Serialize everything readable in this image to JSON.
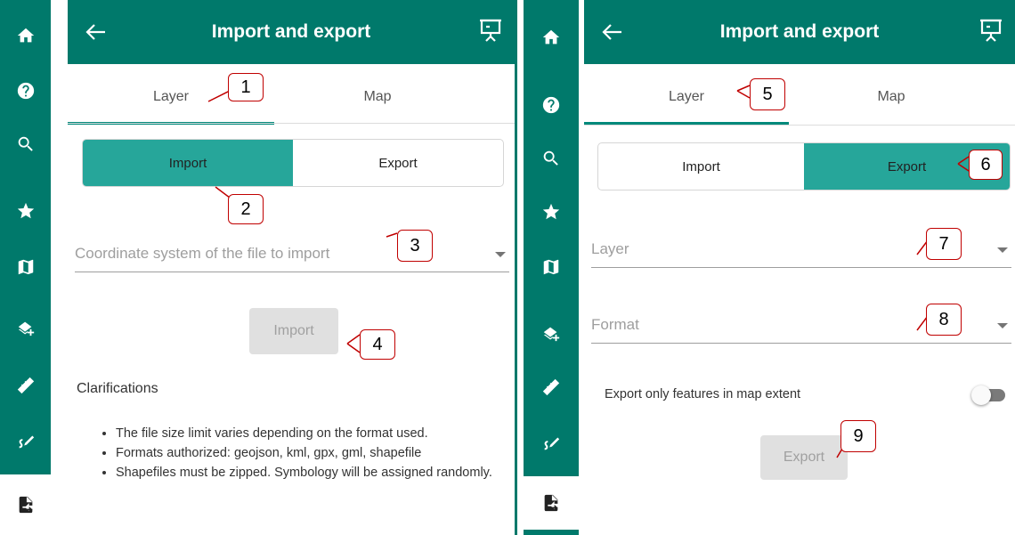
{
  "colors": {
    "primary": "#00796b",
    "accent": "#26a69a",
    "callout": "#c00000"
  },
  "rail_icons": [
    "home-icon",
    "help-icon",
    "search-icon",
    "star-icon",
    "map-icon",
    "add-layer-icon",
    "ruler-icon",
    "draw-icon",
    "import-export-icon"
  ],
  "left": {
    "header": {
      "title": "Import and export"
    },
    "tabs": [
      "Layer",
      "Map"
    ],
    "segment": {
      "import": "Import",
      "export": "Export"
    },
    "select_placeholder": "Coordinate system of the file to import",
    "import_button": "Import",
    "clarifications_title": "Clarifications",
    "notes": [
      "The file size limit varies depending on the format used.",
      "Formats authorized: geojson, kml, gpx, gml, shapefile",
      "Shapefiles must be zipped. Symbology will be assigned randomly."
    ],
    "callouts": [
      "1",
      "2",
      "3",
      "4"
    ]
  },
  "right": {
    "header": {
      "title": "Import and export"
    },
    "tabs": [
      "Layer",
      "Map"
    ],
    "segment": {
      "import": "Import",
      "export": "Export"
    },
    "layer_placeholder": "Layer",
    "format_placeholder": "Format",
    "toggle_label": "Export only features in map extent",
    "toggle_on": false,
    "export_button": "Export",
    "callouts": [
      "5",
      "6",
      "7",
      "8",
      "9"
    ]
  }
}
